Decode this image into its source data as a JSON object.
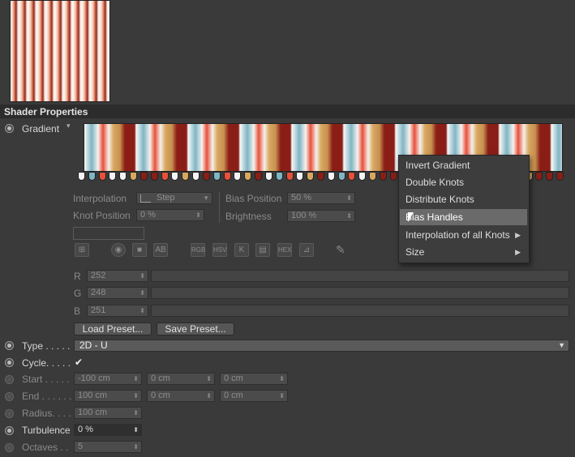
{
  "section": {
    "title": "Shader Properties"
  },
  "gradient": {
    "label": "Gradient"
  },
  "knots": [
    {
      "color": "#f4f4f4"
    },
    {
      "color": "#7fb5c4"
    },
    {
      "color": "#e8503a"
    },
    {
      "color": "#f4f4f4"
    },
    {
      "color": "#f4f4f4"
    },
    {
      "color": "#d8a860"
    },
    {
      "color": "#8a1e16"
    },
    {
      "color": "#8a1e16"
    },
    {
      "color": "#e8503a"
    },
    {
      "color": "#f4f4f4"
    },
    {
      "color": "#d8a860"
    },
    {
      "color": "#f4f4f4"
    },
    {
      "color": "#8a1e16"
    },
    {
      "color": "#7fb5c4"
    },
    {
      "color": "#e8503a"
    },
    {
      "color": "#f4f4f4"
    },
    {
      "color": "#d8a860"
    },
    {
      "color": "#8a1e16"
    },
    {
      "color": "#f4f4f4"
    },
    {
      "color": "#7fb5c4"
    },
    {
      "color": "#e8503a"
    },
    {
      "color": "#f4f4f4"
    },
    {
      "color": "#d8a860"
    },
    {
      "color": "#8a1e16"
    },
    {
      "color": "#f4f4f4"
    },
    {
      "color": "#7fb5c4"
    },
    {
      "color": "#e8503a"
    },
    {
      "color": "#f4f4f4"
    },
    {
      "color": "#d8a860"
    },
    {
      "color": "#8a1e16"
    },
    {
      "color": "#8a1e16"
    },
    {
      "color": "#e8503a"
    },
    {
      "color": "#f4f4f4"
    },
    {
      "color": "#d8a860"
    },
    {
      "color": "#8a1e16"
    },
    {
      "color": "#f4f4f4"
    },
    {
      "color": "#7fb5c4"
    },
    {
      "color": "#e8503a"
    },
    {
      "color": "#f4f4f4"
    },
    {
      "color": "#d8a860"
    },
    {
      "color": "#8a1e16"
    },
    {
      "color": "#7fb5c4"
    },
    {
      "color": "#f4f4f4"
    },
    {
      "color": "#d8a860"
    },
    {
      "color": "#8a1e16"
    },
    {
      "color": "#8a1e16"
    },
    {
      "color": "#8a1e16"
    }
  ],
  "interpolation": {
    "label": "Interpolation",
    "value": "Step"
  },
  "knot_position": {
    "label": "Knot Position",
    "value": "0 %"
  },
  "bias_position": {
    "label": "Bias Position",
    "value": "50 %"
  },
  "brightness": {
    "label": "Brightness",
    "value": "100 %"
  },
  "toolbar_icons": [
    "knot-icon",
    "sphere-icon",
    "square-icon",
    "ab-icon",
    "rgb-icon",
    "hsv-icon",
    "k-icon",
    "swatch-icon",
    "hex-icon",
    "picker-icon",
    "eyedropper-icon"
  ],
  "rgb": {
    "r": {
      "label": "R",
      "value": "252"
    },
    "g": {
      "label": "G",
      "value": "248"
    },
    "b": {
      "label": "B",
      "value": "251"
    }
  },
  "buttons": {
    "load": "Load Preset...",
    "save": "Save Preset..."
  },
  "context_menu": {
    "items": [
      {
        "label": "Invert Gradient",
        "submenu": false,
        "highlighted": false
      },
      {
        "label": "Double Knots",
        "submenu": false,
        "highlighted": false
      },
      {
        "label": "Distribute Knots",
        "submenu": false,
        "highlighted": false
      },
      {
        "label": "Bias Handles",
        "submenu": false,
        "highlighted": true
      },
      {
        "label": "Interpolation of all Knots",
        "submenu": true,
        "highlighted": false
      },
      {
        "label": "Size",
        "submenu": true,
        "highlighted": false
      }
    ]
  },
  "params": {
    "type": {
      "label": "Type . . . . .",
      "value": "2D - U"
    },
    "cycle": {
      "label": "Cycle. . . . .",
      "checked": true,
      "mark": "✔"
    },
    "start": {
      "label": "Start . . . . .",
      "values": [
        "-100 cm",
        "0 cm",
        "0 cm"
      ]
    },
    "end": {
      "label": "End . . . . . .",
      "values": [
        "100 cm",
        "0 cm",
        "0 cm"
      ]
    },
    "radius": {
      "label": "Radius. . . .",
      "value": "100 cm"
    },
    "turbulence": {
      "label": "Turbulence",
      "value": "0 %"
    },
    "octaves": {
      "label": "Octaves . .",
      "value": "5"
    }
  }
}
